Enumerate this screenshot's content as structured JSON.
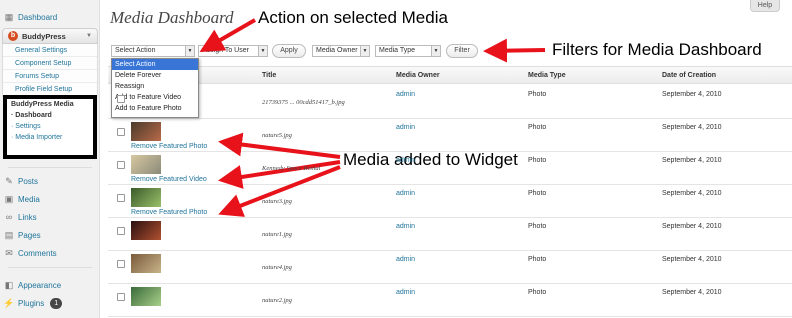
{
  "sidebar": {
    "dashboard": "Dashboard",
    "buddypress": "BuddyPress",
    "bp_items": [
      "General Settings",
      "Component Setup",
      "Forums Setup",
      "Profile Field Setup"
    ],
    "bpm_title": "BuddyPress Media",
    "bpm_items": [
      "· Dashboard",
      "· Settings",
      "· Media Importer"
    ],
    "posts": "Posts",
    "media": "Media",
    "links": "Links",
    "pages": "Pages",
    "comments": "Comments",
    "appearance": "Appearance",
    "plugins": "Plugins",
    "plugins_badge": "1"
  },
  "page": {
    "title": "Media Dashboard",
    "help": "Help"
  },
  "toolbar": {
    "bulk_action": "Select Action",
    "assign": "Assign To User",
    "apply": "Apply",
    "owner": "Media Owner",
    "type": "Media Type",
    "filter": "Filter"
  },
  "dropdown_options": [
    "Select Action",
    "Delete Forever",
    "Reassign",
    "Add to Feature Video",
    "Add to Feature Photo"
  ],
  "table": {
    "headers": {
      "title": "Title",
      "owner": "Media Owner",
      "type": "Media Type",
      "date": "Date of Creation"
    },
    "rows": [
      {
        "title": "21739375 ... 00cdd51417_b.jpg",
        "owner": "admin",
        "type": "Photo",
        "date": "September 4, 2010",
        "feature": ""
      },
      {
        "title": "nature5.jpg",
        "owner": "admin",
        "type": "Photo",
        "date": "September 4, 2010",
        "feature": "Remove Featured Photo"
      },
      {
        "title": "Kennedy Space Rental",
        "owner": "admin",
        "type": "Photo",
        "date": "September 4, 2010",
        "feature": "Remove Featured Video"
      },
      {
        "title": "nature3.jpg",
        "owner": "admin",
        "type": "Photo",
        "date": "September 4, 2010",
        "feature": "Remove Featured Photo"
      },
      {
        "title": "nature1.jpg",
        "owner": "admin",
        "type": "Photo",
        "date": "September 4, 2010",
        "feature": ""
      },
      {
        "title": "nature4.jpg",
        "owner": "admin",
        "type": "Photo",
        "date": "September 4, 2010",
        "feature": ""
      },
      {
        "title": "nature2.jpg",
        "owner": "admin",
        "type": "Photo",
        "date": "September 4, 2010",
        "feature": ""
      }
    ]
  },
  "annotations": {
    "action": "Action on selected Media",
    "filters": "Filters for Media Dashboard",
    "widget": "Media added to Widget"
  },
  "colors": {
    "link": "#21759b",
    "arrow": "#e8121a",
    "highlight": "#3875d7",
    "bp_logo": "#d54e21"
  }
}
